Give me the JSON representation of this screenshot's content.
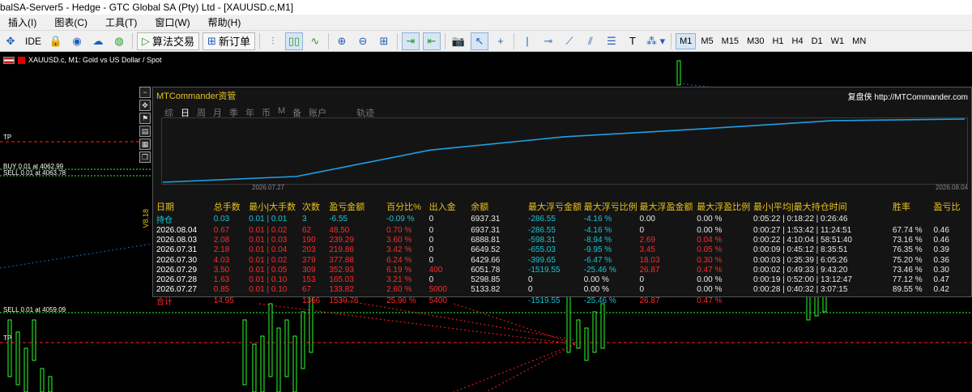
{
  "window": {
    "title": "balSA-Server5 - Hedge - GTC Global SA (Pty) Ltd - [XAUUSD.c,M1]"
  },
  "menu": [
    "插入(I)",
    "图表(C)",
    "工具(T)",
    "窗口(W)",
    "帮助(H)"
  ],
  "toolbar": {
    "ide_label": "IDE",
    "algo_label": "算法交易",
    "new_order_label": "新订单",
    "timeframes": [
      "M1",
      "M5",
      "M15",
      "M30",
      "H1",
      "H4",
      "D1",
      "W1",
      "MN"
    ],
    "active_timeframe": "M1"
  },
  "chart": {
    "symbol_header": "XAUUSD.c, M1:  Gold vs US Dollar / Spot",
    "levels": {
      "tp_top": "TP",
      "buy": "BUY 0.01 at 4062.99",
      "sell_top": "SELL 0.01 at 4063.78",
      "sell_bottom": "SELL 0.01 at 4059.09",
      "tp_bottom": "TP"
    }
  },
  "panel": {
    "title": "MTCommander资管",
    "title_right": "复盘侠 http://MTCommander.com",
    "tabs": [
      "综",
      "日",
      "周",
      "月",
      "季",
      "年",
      "币",
      "M",
      "备",
      "账户",
      "轨迹"
    ],
    "active_tab": "日",
    "date_start": "2026.07.27",
    "date_end": "2026.08.04",
    "vertical_label": "V8.18",
    "headers": [
      "日期",
      "总手数",
      "最小|大手数",
      "次数",
      "盈亏金额",
      "百分比%",
      "出入金",
      "余额",
      "最大浮亏金额",
      "最大浮亏比例",
      "最大浮盈金额",
      "最大浮盈比例",
      "最小|平均|最大持仓时间",
      "胜率",
      "盈亏比"
    ],
    "holding": [
      "持仓",
      "0.03",
      "0.01 | 0.01",
      "3",
      "-6.55",
      "-0.09 %",
      "0",
      "6937.31",
      "-286.55",
      "-4.16 %",
      "0.00",
      "0.00 %",
      "0:05:22 | 0:18:22 | 0:26:46",
      "",
      ""
    ],
    "rows": [
      [
        "2026.08.04",
        "0.67",
        "0.01 | 0.02",
        "62",
        "48.50",
        "0.70 %",
        "0",
        "6937.31",
        "-286.55",
        "-4.16 %",
        "0",
        "0.00 %",
        "0:00:27 | 1:53:42 | 11:24:51",
        "67.74 %",
        "0.46"
      ],
      [
        "2026.08.03",
        "2.08",
        "0.01 | 0.03",
        "190",
        "239.29",
        "3.60 %",
        "0",
        "6888.81",
        "-598.31",
        "-8.94 %",
        "2.69",
        "0.04 %",
        "0:00:22 | 4:10:04 | 58:51:40",
        "73.16 %",
        "0.46"
      ],
      [
        "2026.07.31",
        "2.18",
        "0.01 | 0.04",
        "203",
        "219.86",
        "3.42 %",
        "0",
        "6649.52",
        "-655.03",
        "-9.95 %",
        "3.45",
        "0.05 %",
        "0:00:09 | 0:45:12 | 8:35:51",
        "76.35 %",
        "0.39"
      ],
      [
        "2026.07.30",
        "4.03",
        "0.01 | 0.02",
        "379",
        "377.88",
        "6.24 %",
        "0",
        "6429.66",
        "-399.65",
        "-6.47 %",
        "18.03",
        "0.30 %",
        "0:00:03 | 0:35:39 | 6:05:26",
        "75.20 %",
        "0.36"
      ],
      [
        "2026.07.29",
        "3.50",
        "0.01 | 0.05",
        "309",
        "352.93",
        "6.19 %",
        "400",
        "6051.78",
        "-1519.55",
        "-25.46 %",
        "26.87",
        "0.47 %",
        "0:00:02 | 0:49:33 | 9:43:20",
        "73.46 %",
        "0.30"
      ],
      [
        "2026.07.28",
        "1.63",
        "0.01 | 0.10",
        "153",
        "165.03",
        "3.21 %",
        "0",
        "5298.85",
        "0",
        "0.00 %",
        "0",
        "0.00 %",
        "0:00:19 | 0:52:00 | 13:12:47",
        "77.12 %",
        "0.47"
      ],
      [
        "2026.07.27",
        "0.85",
        "0.01 | 0.10",
        "67",
        "133.82",
        "2.60 %",
        "5000",
        "5133.82",
        "0",
        "0.00 %",
        "0",
        "0.00 %",
        "0:00:28 | 0:40:32 | 3:07:15",
        "89.55 %",
        "0.42"
      ]
    ],
    "total": [
      "合计",
      "14.95",
      "",
      "1366",
      "1530.76",
      "25.96 %",
      "5400",
      "",
      "-1519.55",
      "-25.46 %",
      "26.87",
      "0.47 %",
      "",
      "",
      ""
    ],
    "balance_curve": [
      5133.82,
      5298.85,
      6051.78,
      6429.66,
      6649.52,
      6888.81,
      6937.31
    ]
  },
  "colors": {
    "accent": "#e8c21e",
    "loss": "#ff2a2a",
    "profit": "#15c6d6",
    "candle": "#2aff2a"
  }
}
